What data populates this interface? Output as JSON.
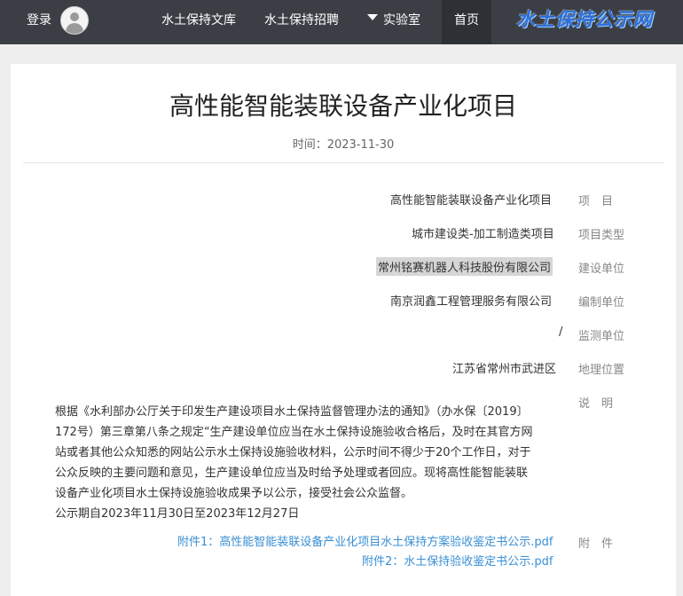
{
  "header": {
    "logo_text": "水土保持公示网",
    "nav": {
      "home": "首页",
      "lab": "实验室",
      "recruit": "水土保持招聘",
      "library": "水土保持文库"
    },
    "login": "登录"
  },
  "article": {
    "title": "高性能智能装联设备产业化项目",
    "time_label": "时间：2023-11-30",
    "fields": {
      "project_label": "项　目",
      "project_value": "高性能智能装联设备产业化项目",
      "type_label": "项目类型",
      "type_value": "城市建设类-加工制造类项目",
      "builder_label": "建设单位",
      "builder_value": "常州铭赛机器人科技股份有限公司",
      "compiler_label": "编制单位",
      "compiler_value": "南京润鑫工程管理服务有限公司",
      "monitor_label": "监测单位",
      "monitor_value": "/",
      "location_label": "地理位置",
      "location_value": "江苏省常州市武进区",
      "desc_label": "说　明",
      "desc_lines": [
        "根据《水利部办公厅关于印发生产建设项目水土保持监督管理办法的通知》（办水保〔2019〕",
        "172号）第三章第八条之规定“生产建设单位应当在水土保持设施验收合格后，及时在其官方网",
        "站或者其他公众知悉的网站公示水土保持设施验收材料，公示时间不得少于20个工作日，对于",
        "公众反映的主要问题和意见，生产建设单位应当及时给予处理或者回应。现将高性能智能装联",
        "设备产业化项目水土保持设施验收成果予以公示，接受社会公众监督。",
        "公示期自2023年11月30日至2023年12月27日"
      ],
      "attach_label": "附　件",
      "attachments": [
        "附件1：高性能智能装联设备产业化项目水土保持方案验收鉴定书公示.pdf",
        "附件2：水土保持验收鉴定书公示.pdf"
      ]
    }
  }
}
